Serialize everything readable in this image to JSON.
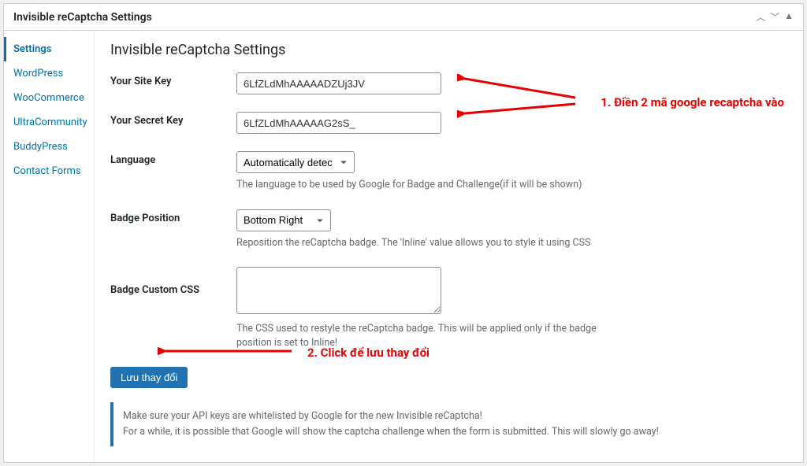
{
  "header": {
    "title": "Invisible reCaptcha Settings"
  },
  "sidebar": {
    "items": [
      {
        "label": "Settings",
        "active": true
      },
      {
        "label": "WordPress"
      },
      {
        "label": "WooCommerce"
      },
      {
        "label": "UltraCommunity"
      },
      {
        "label": "BuddyPress"
      },
      {
        "label": "Contact Forms"
      }
    ]
  },
  "page": {
    "title": "Invisible reCaptcha Settings"
  },
  "form": {
    "site_key": {
      "label": "Your Site Key",
      "value": "6LfZLdMhAAAAADZUj3JV"
    },
    "secret_key": {
      "label": "Your Secret Key",
      "value": "6LfZLdMhAAAAAG2sS_"
    },
    "language": {
      "label": "Language",
      "value": "Automatically detect",
      "help": "The language to be used by Google for Badge and Challenge(if it will be shown)"
    },
    "badge_position": {
      "label": "Badge Position",
      "value": "Bottom Right",
      "help": "Reposition the reCaptcha badge. The 'Inline' value allows you to style it using CSS"
    },
    "badge_css": {
      "label": "Badge Custom CSS",
      "value": "",
      "help": "The CSS used to restyle the reCaptcha badge. This will be applied only if the badge position is set to Inline!"
    },
    "submit": "Lưu thay đổi"
  },
  "notice": {
    "line1": "Make sure your API keys are whitelisted by Google for the new Invisible reCaptcha!",
    "line2": "For a while, it is possible that Google will show the captcha challenge when the form is submitted. This will slowly go away!"
  },
  "annotations": {
    "a1": "1. Điền 2 mã google recaptcha vào",
    "a2": "2. Click để lưu thay đổi"
  }
}
